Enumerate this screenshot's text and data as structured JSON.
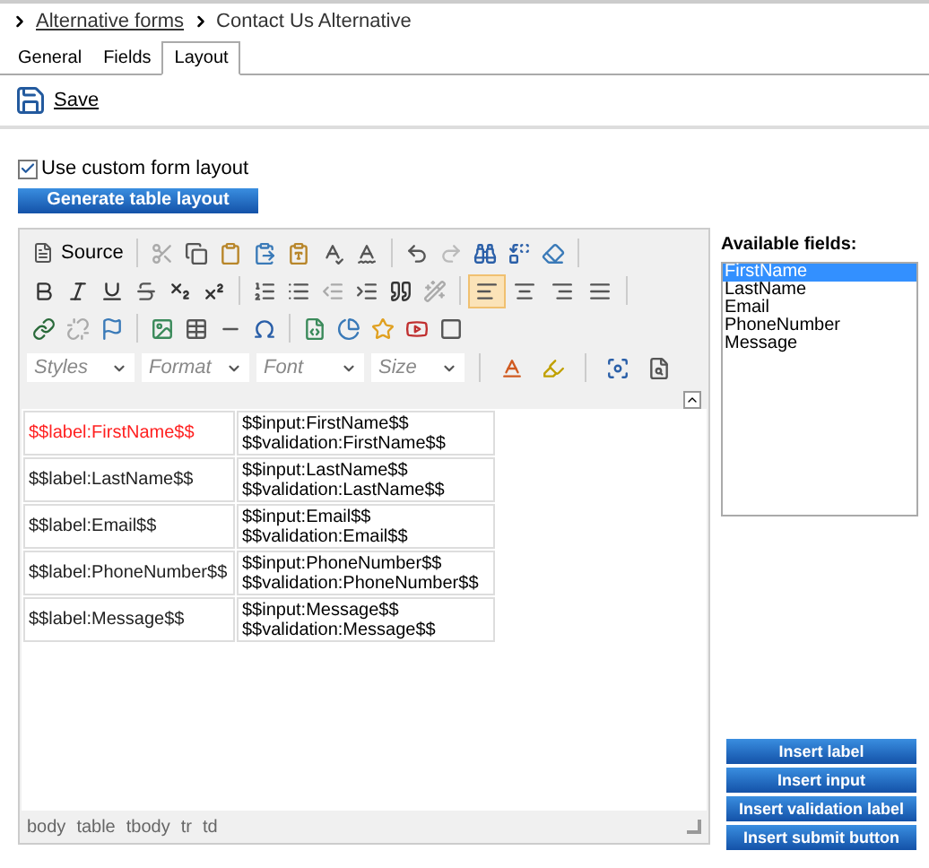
{
  "breadcrumb": [
    {
      "text": "Alternative forms",
      "link": true
    },
    {
      "text": "Contact Us Alternative",
      "link": false
    }
  ],
  "tabs": [
    {
      "label": "General",
      "selected": false
    },
    {
      "label": "Fields",
      "selected": false
    },
    {
      "label": "Layout",
      "selected": true
    }
  ],
  "save": "Save",
  "custom_layout": {
    "label": "Use custom form layout",
    "checked": true
  },
  "generate_button": "Generate table layout",
  "editor": {
    "source": "Source",
    "align_buttons": [
      {
        "kind": "left",
        "selected": true
      },
      {
        "kind": "center",
        "selected": false
      },
      {
        "kind": "right",
        "selected": false
      },
      {
        "kind": "justify",
        "selected": false
      }
    ],
    "dropdowns": [
      "Styles",
      "Format",
      "Font",
      "Size"
    ],
    "rows": [
      {
        "label": "$$label:FirstName$$",
        "highlighted": true,
        "input": "$$input:FirstName$$",
        "validation": "$$validation:FirstName$$"
      },
      {
        "label": "$$label:LastName$$",
        "highlighted": false,
        "input": "$$input:LastName$$",
        "validation": "$$validation:LastName$$"
      },
      {
        "label": "$$label:Email$$",
        "highlighted": false,
        "input": "$$input:Email$$",
        "validation": "$$validation:Email$$"
      },
      {
        "label": "$$label:PhoneNumber$$",
        "highlighted": false,
        "input": "$$input:PhoneNumber$$",
        "validation": "$$validation:PhoneNumber$$"
      },
      {
        "label": "$$label:Message$$",
        "highlighted": false,
        "input": "$$input:Message$$",
        "validation": "$$validation:Message$$"
      }
    ],
    "path": [
      "body",
      "table",
      "tbody",
      "tr",
      "td"
    ]
  },
  "available_fields": {
    "title": "Available fields:",
    "items": [
      {
        "label": "FirstName",
        "selected": true
      },
      {
        "label": "LastName",
        "selected": false
      },
      {
        "label": "Email",
        "selected": false
      },
      {
        "label": "PhoneNumber",
        "selected": false
      },
      {
        "label": "Message",
        "selected": false
      }
    ]
  },
  "insert_buttons": [
    "Insert label",
    "Insert input",
    "Insert validation label",
    "Insert submit button"
  ]
}
